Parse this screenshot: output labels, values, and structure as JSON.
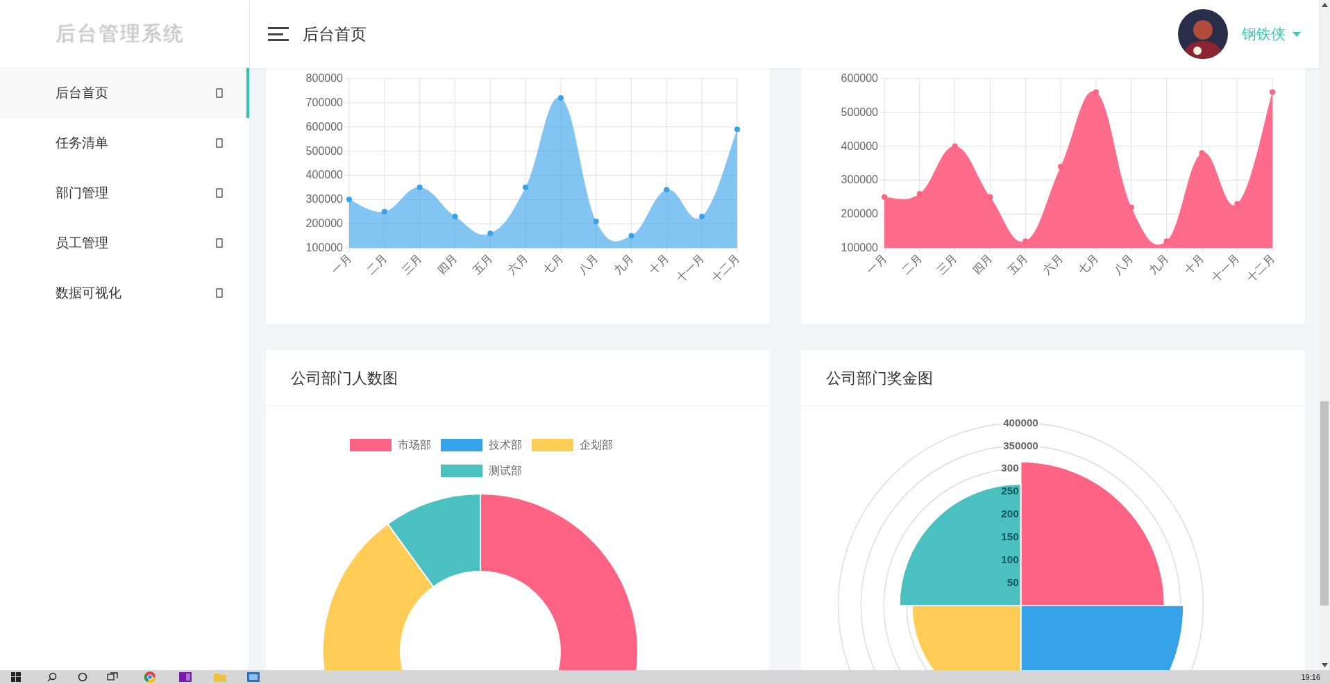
{
  "sidebar": {
    "logo": "后台管理系统",
    "items": [
      {
        "label": "后台首页",
        "selected": true
      },
      {
        "label": "任务清单",
        "selected": false
      },
      {
        "label": "部门管理",
        "selected": false
      },
      {
        "label": "员工管理",
        "selected": false
      },
      {
        "label": "数据可视化",
        "selected": false
      }
    ]
  },
  "header": {
    "title": "后台首页",
    "user": {
      "name": "钢铁侠"
    }
  },
  "line_charts": [
    {
      "chart_data": {
        "type": "area",
        "categories": [
          "一月",
          "二月",
          "三月",
          "四月",
          "五月",
          "六月",
          "七月",
          "八月",
          "九月",
          "十月",
          "十一月",
          "十二月"
        ],
        "grid": true,
        "series": [
          {
            "color": "#36a2eb",
            "values": [
              300000,
              250000,
              350000,
              230000,
              160000,
              350000,
              720000,
              210000,
              150000,
              340000,
              230000,
              590000
            ]
          }
        ],
        "ylim": [
          100000,
          800000
        ],
        "yticks": [
          100000,
          200000,
          300000,
          400000,
          500000,
          600000,
          700000,
          800000
        ]
      }
    },
    {
      "chart_data": {
        "type": "area",
        "categories": [
          "一月",
          "二月",
          "三月",
          "四月",
          "五月",
          "六月",
          "七月",
          "八月",
          "九月",
          "十月",
          "十一月",
          "十二月"
        ],
        "grid": true,
        "series": [
          {
            "color": "#ff6384",
            "values": [
              250000,
              260000,
              400000,
              250000,
              120000,
              340000,
              560000,
              220000,
              120000,
              380000,
              230000,
              560000
            ]
          }
        ],
        "ylim": [
          100000,
          600000
        ],
        "yticks": [
          100000,
          200000,
          300000,
          400000,
          500000,
          600000
        ]
      }
    }
  ],
  "headcount_card": {
    "title": "公司部门人数图",
    "legend": [
      {
        "label": "市场部",
        "color": "#ff6384"
      },
      {
        "label": "技术部",
        "color": "#36a2eb"
      },
      {
        "label": "企划部",
        "color": "#ffcd56"
      },
      {
        "label": "测试部",
        "color": "#4bc0c0"
      }
    ]
  },
  "bonus_card": {
    "title": "公司部门奖金图",
    "outer_ring_label": "400000",
    "tick_labels": [
      "350000",
      "300",
      "250",
      "200",
      "150",
      "100",
      "50"
    ]
  },
  "taskbar": {
    "time": "19:16"
  }
}
